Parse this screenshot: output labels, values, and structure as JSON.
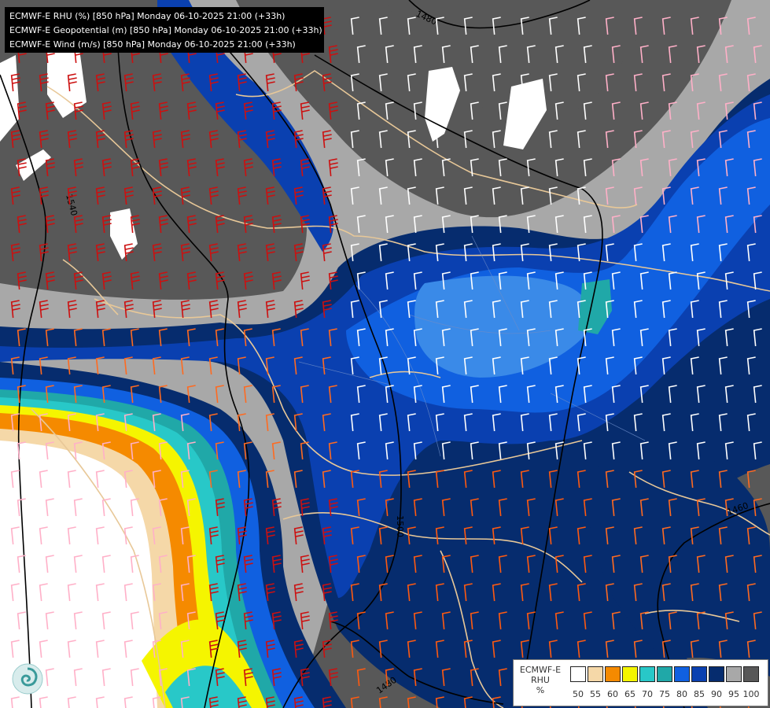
{
  "header": {
    "lines": [
      "ECMWF-E RHU (%) [850 hPa] Monday 06-10-2025 21:00 (+33h)",
      "ECMWF-E Geopotential (m) [850 hPa] Monday 06-10-2025 21:00 (+33h)",
      "ECMWF-E Wind (m/s) [850 hPa] Monday 06-10-2025 21:00 (+33h)"
    ]
  },
  "contours": {
    "labels": [
      "1480",
      "1540",
      "1500",
      "1460",
      "1480"
    ]
  },
  "legend": {
    "title_lines": [
      "ECMWF-E",
      "RHU",
      "%"
    ],
    "levels": [
      "50",
      "55",
      "60",
      "65",
      "70",
      "75",
      "80",
      "85",
      "90",
      "95",
      "100"
    ],
    "colors": [
      "#ffffff",
      "#f5d8a8",
      "#f58a00",
      "#f5f500",
      "#28c8c8",
      "#20a8a8",
      "#1060e0",
      "#0a40b0",
      "#062c6e",
      "#a8a8a8",
      "#585858"
    ]
  },
  "logo": {
    "icon": "ecmwf-swirl-icon"
  }
}
